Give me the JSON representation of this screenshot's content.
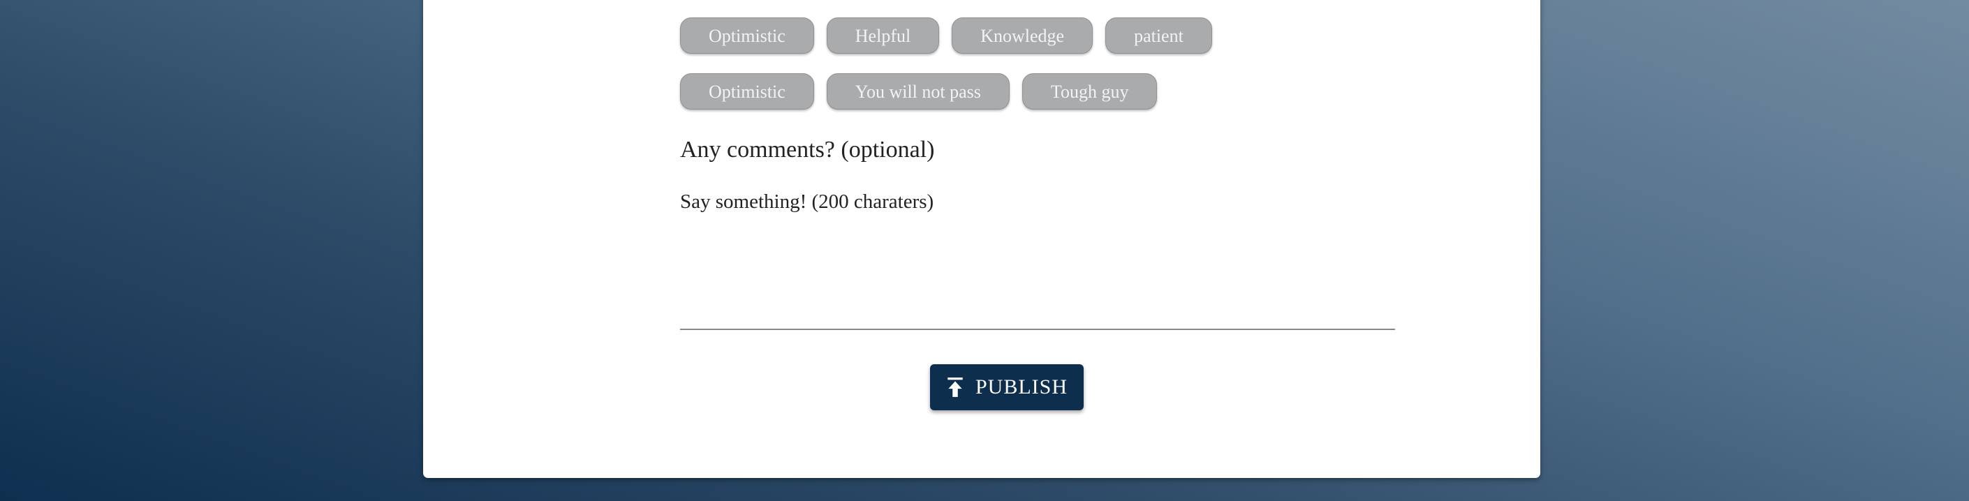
{
  "tags": {
    "row1": [
      "Optimistic",
      "Helpful",
      "Knowledge",
      "patient"
    ],
    "row2": [
      "Optimistic",
      "You will not pass",
      "Tough guy"
    ]
  },
  "comments": {
    "title": "Any comments? (optional)",
    "placeholder": "Say something! (200 charaters)",
    "value": ""
  },
  "publish": {
    "label": "PUBLISH",
    "icon": "publish-icon"
  },
  "colors": {
    "button": "#0e2e4d",
    "chip": "#aaabad",
    "background_dark": "#0f2f50",
    "background_light": "#738ba1"
  }
}
